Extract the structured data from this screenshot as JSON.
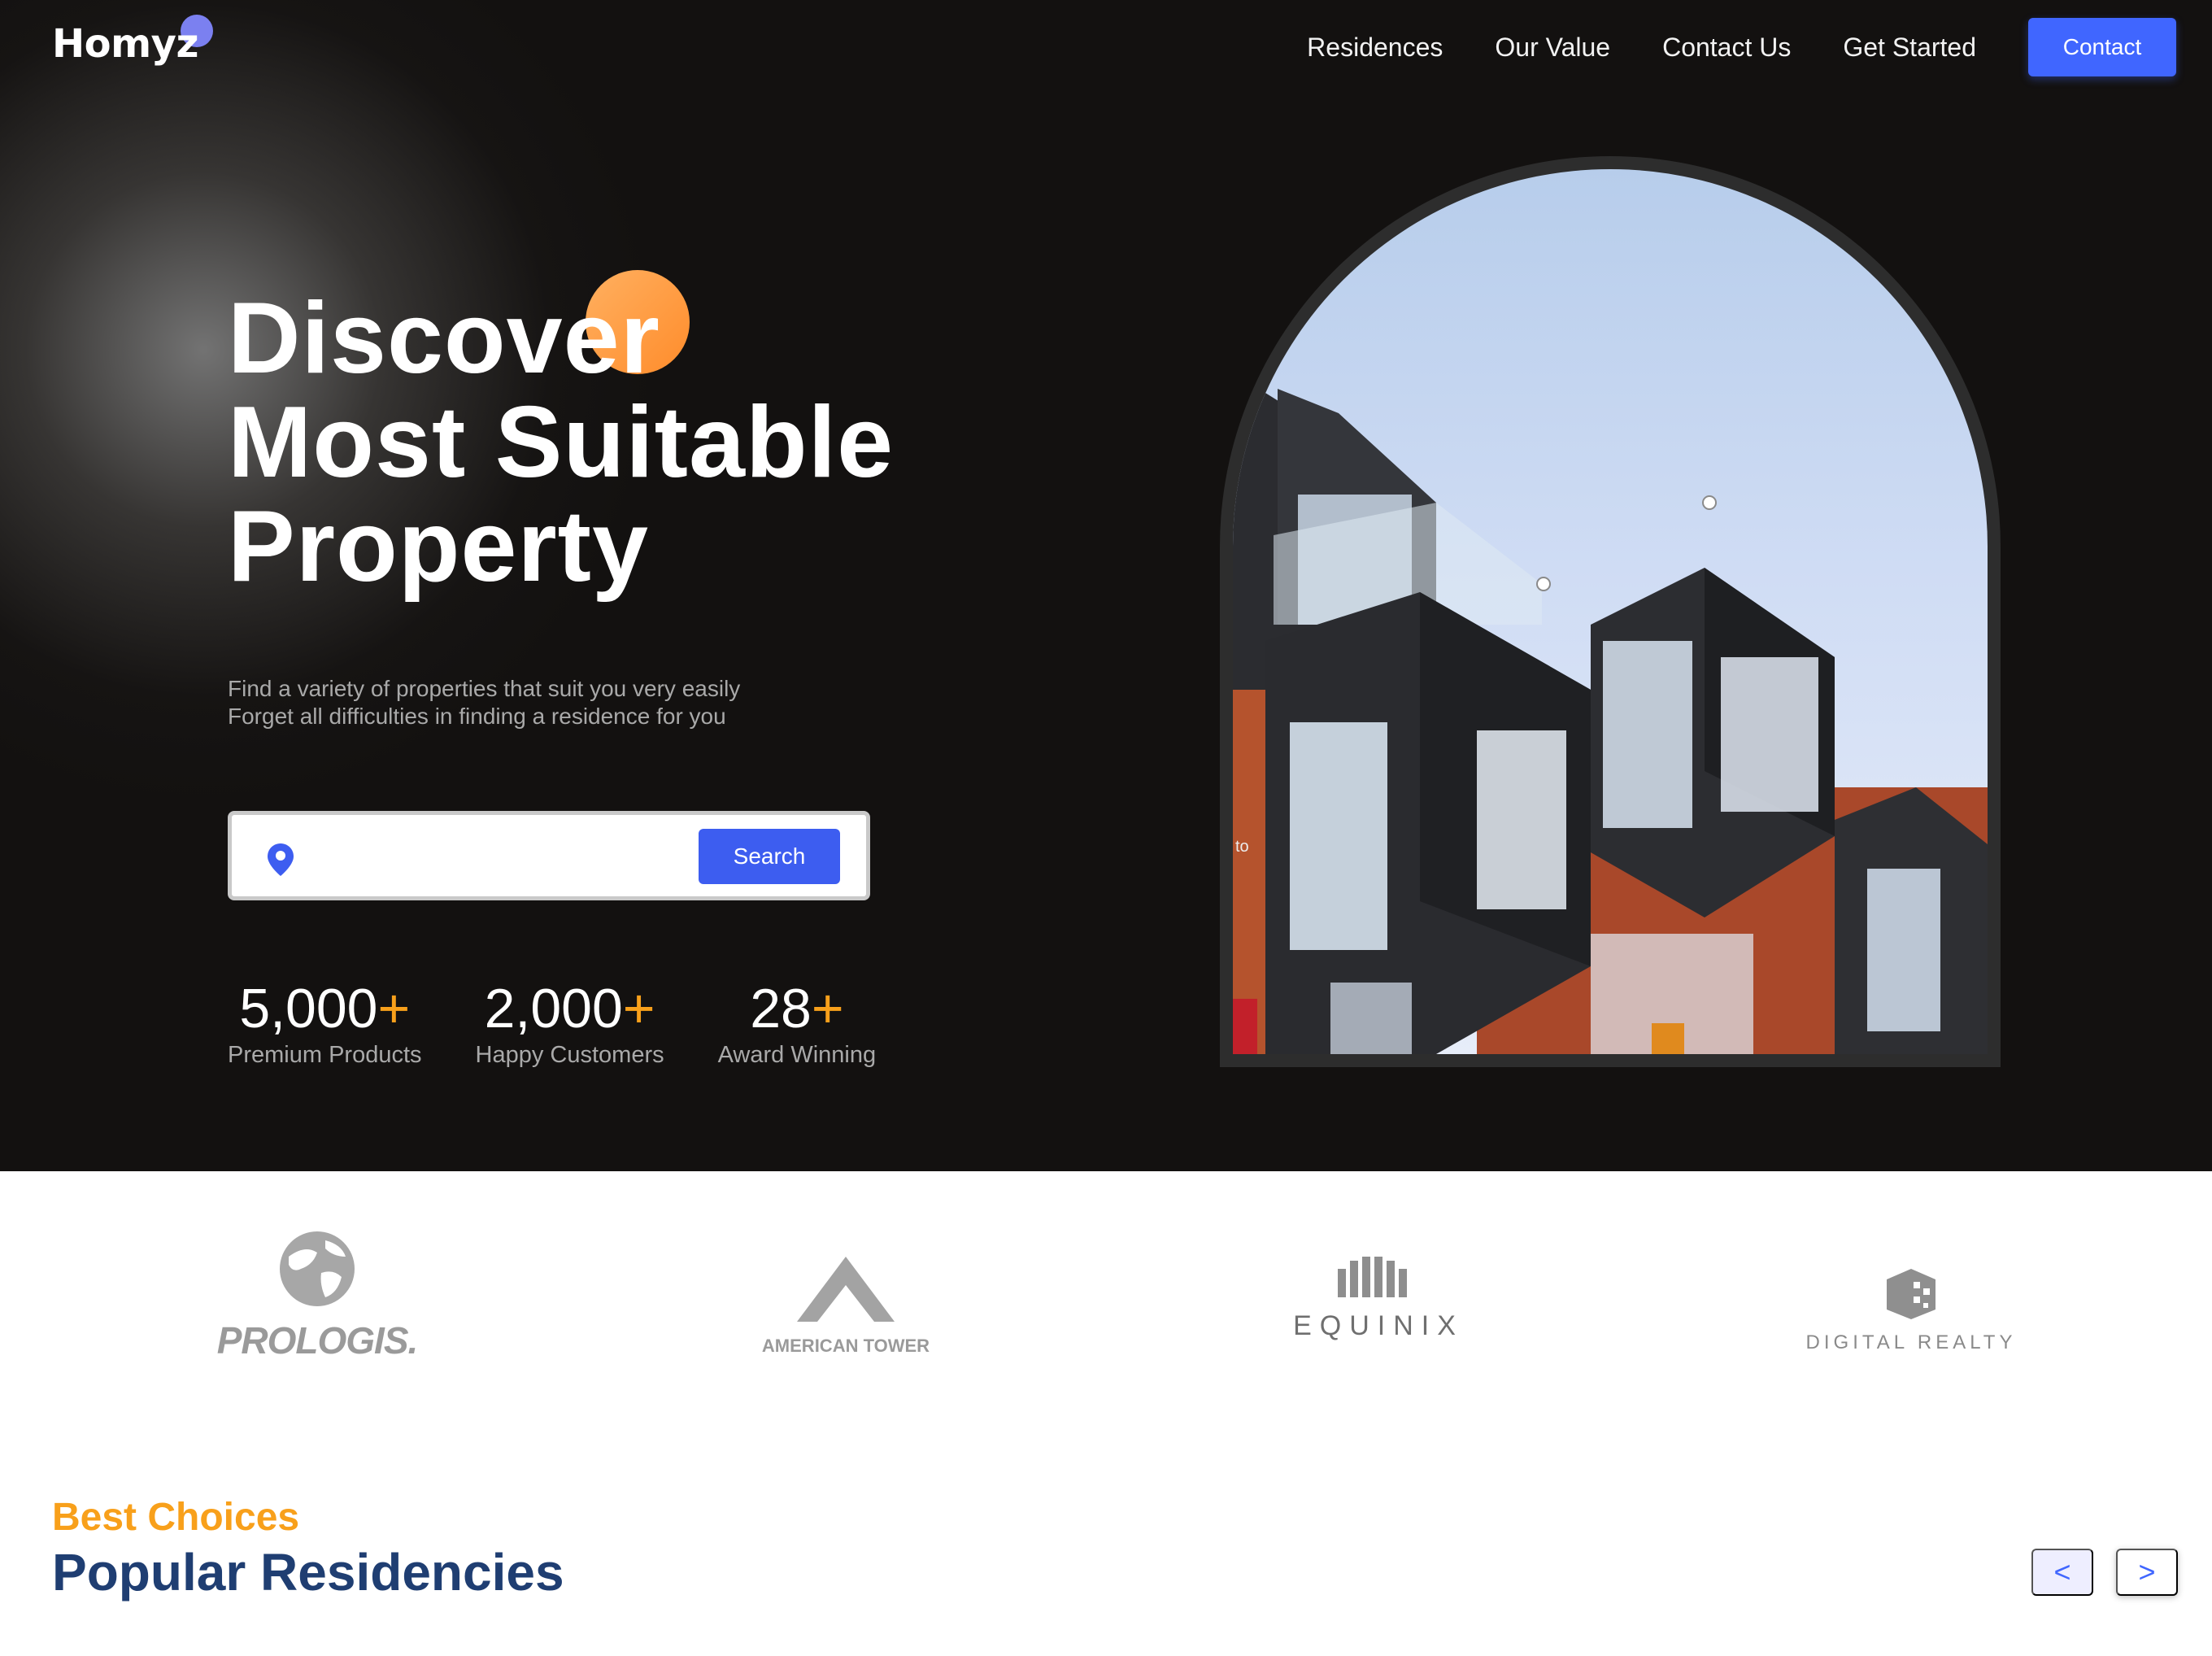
{
  "brand": {
    "name": "Homyz"
  },
  "nav": {
    "links": [
      "Residences",
      "Our Value",
      "Contact Us",
      "Get Started"
    ],
    "cta": "Contact"
  },
  "hero": {
    "title_lines": [
      "Discover",
      "Most Suitable",
      "Property"
    ],
    "subtitle_lines": [
      "Find a variety of properties that suit you very easily",
      "Forget all difficulties in finding a residence for you"
    ],
    "search": {
      "value": "",
      "button": "Search"
    },
    "stats": [
      {
        "value": "5,000",
        "suffix": "+",
        "label": "Premium Products"
      },
      {
        "value": "2,000",
        "suffix": "+",
        "label": "Happy Customers"
      },
      {
        "value": "28",
        "suffix": "+",
        "label": "Award Winning"
      }
    ],
    "image_caption": "to"
  },
  "partners": [
    "PROLOGIS.",
    "AMERICAN TOWER",
    "EQUINIX",
    "DIGITAL REALTY"
  ],
  "residencies": {
    "eyebrow": "Best Choices",
    "title": "Popular Residencies",
    "prev": "<",
    "next": ">"
  },
  "colors": {
    "hero_bg": "#131110",
    "accent_blue": "#4066ff",
    "accent_orange": "#f8a01b",
    "title_navy": "#1f3e72"
  }
}
